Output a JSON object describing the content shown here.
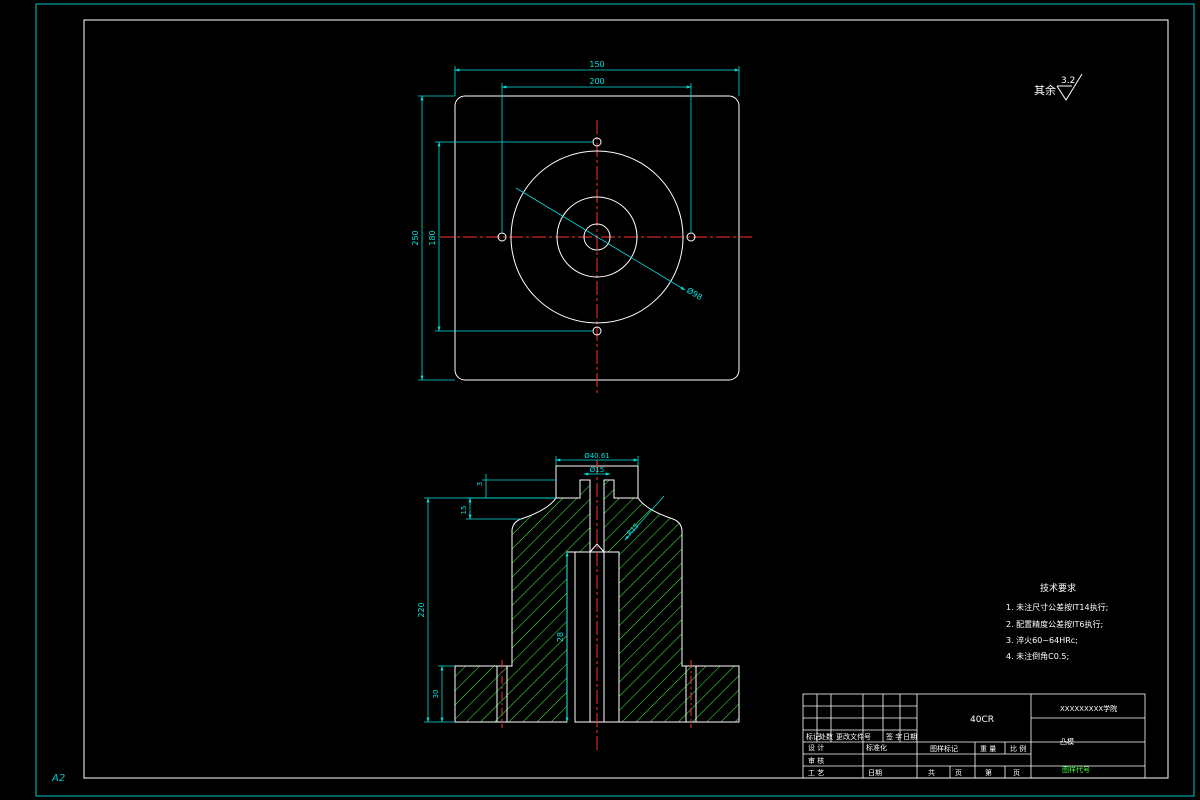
{
  "sheet": {
    "size_label": "A2"
  },
  "top_view": {
    "dims": {
      "overall_width": "150",
      "hole_spacing_x": "200",
      "overall_height": "250",
      "hole_spacing_y": "180",
      "diameter_label": "Ø98"
    }
  },
  "section_view": {
    "dims": {
      "top_diameter": "Ø40.61",
      "bore_diameter": "Ø15",
      "step_small": "3",
      "step_top": "15",
      "overall_height": "220",
      "inner_depth": "28",
      "flange_height": "30",
      "fillet_radius": "R15"
    }
  },
  "surface_finish": {
    "label": "其余",
    "value": "3.2"
  },
  "tech_requirements": {
    "title": "技术要求",
    "items": [
      "1. 未注尺寸公差按IT14执行;",
      "2. 配置精度公差按IT6执行;",
      "3. 淬火60~64HRc;",
      "4. 未注倒角C0.5;"
    ]
  },
  "title_block": {
    "material": "40CR",
    "school": "XXXXXXXXX学院",
    "part_name": "凸模",
    "drawing_number": "图样代号",
    "row_labels": {
      "mark": "标记",
      "count": "处数",
      "change_doc": "更改文件号",
      "signature": "签 字",
      "date": "日期",
      "design": "设 计",
      "standardize": "标准化",
      "review": "审 核",
      "process": "工 艺",
      "date2": "日期",
      "stage_mark": "图样标记",
      "weight": "重 量",
      "scale": "比 例",
      "total": "共",
      "page": "页",
      "sheet_n": "第",
      "page2": "页"
    }
  },
  "colors": {
    "frame": "#00c8c8",
    "outline": "#ffffff",
    "centerline": "#ff3030",
    "dimension": "#00e0e0",
    "hatch": "#40ff40",
    "text_green": "#40ff40"
  }
}
